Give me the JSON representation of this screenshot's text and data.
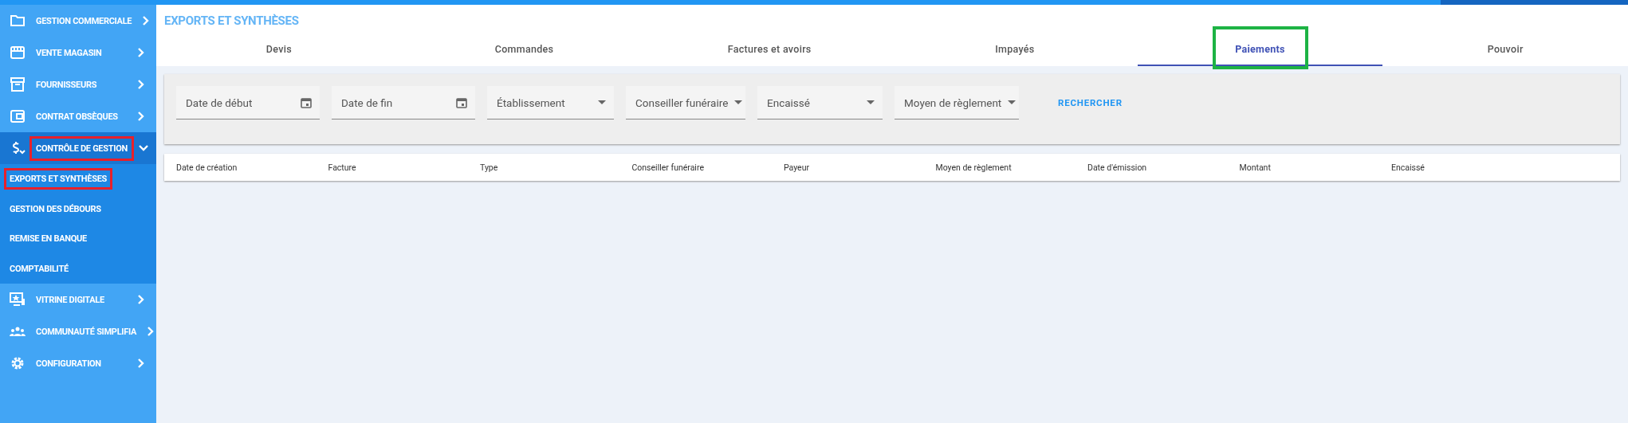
{
  "page_title": "EXPORTS ET SYNTHÈSES",
  "sidebar": {
    "items": [
      {
        "label": "GESTION COMMERCIALE",
        "expanded": false
      },
      {
        "label": "VENTE MAGASIN",
        "expanded": false
      },
      {
        "label": "FOURNISSEURS",
        "expanded": false
      },
      {
        "label": "CONTRAT OBSÈQUES",
        "expanded": false
      },
      {
        "label": "CONTRÔLE DE GESTION",
        "expanded": true,
        "color": "#e8202a",
        "children": [
          {
            "label": "EXPORTS ET SYNTHÈSES",
            "color": "#e8202a"
          },
          {
            "label": "GESTION DES DÉBOURS"
          },
          {
            "label": "REMISE EN BANQUE"
          },
          {
            "label": "COMPTABILITÉ"
          }
        ]
      },
      {
        "label": "VITRINE DIGITALE",
        "expanded": false
      },
      {
        "label": "COMMUNAUTÉ SIMPLIFIA",
        "expanded": false
      },
      {
        "label": "CONFIGURATION",
        "expanded": false
      }
    ]
  },
  "tabs": [
    {
      "label": "Devis",
      "selected": false
    },
    {
      "label": "Commandes",
      "selected": false
    },
    {
      "label": "Factures et avoirs",
      "selected": false
    },
    {
      "label": "Impayés",
      "selected": false
    },
    {
      "label": "Paiements",
      "selected": true,
      "color": "#1db344"
    },
    {
      "label": "Pouvoir",
      "selected": false
    }
  ],
  "filters": [
    {
      "kind": "date",
      "placeholder": "Date de début"
    },
    {
      "kind": "date",
      "placeholder": "Date de fin"
    },
    {
      "kind": "select",
      "placeholder": "Établissement"
    },
    {
      "kind": "select",
      "placeholder": "Conseiller funéraire"
    },
    {
      "kind": "select",
      "placeholder": "Encaissé"
    },
    {
      "kind": "select",
      "placeholder": "Moyen de règlement"
    }
  ],
  "search_button": "RECHERCHER",
  "table": {
    "columns": [
      "Date de création",
      "Facture",
      "Type",
      "Conseiller funéraire",
      "Payeur",
      "Moyen de règlement",
      "Date d'émission",
      "Montant",
      "Encaissé"
    ]
  }
}
